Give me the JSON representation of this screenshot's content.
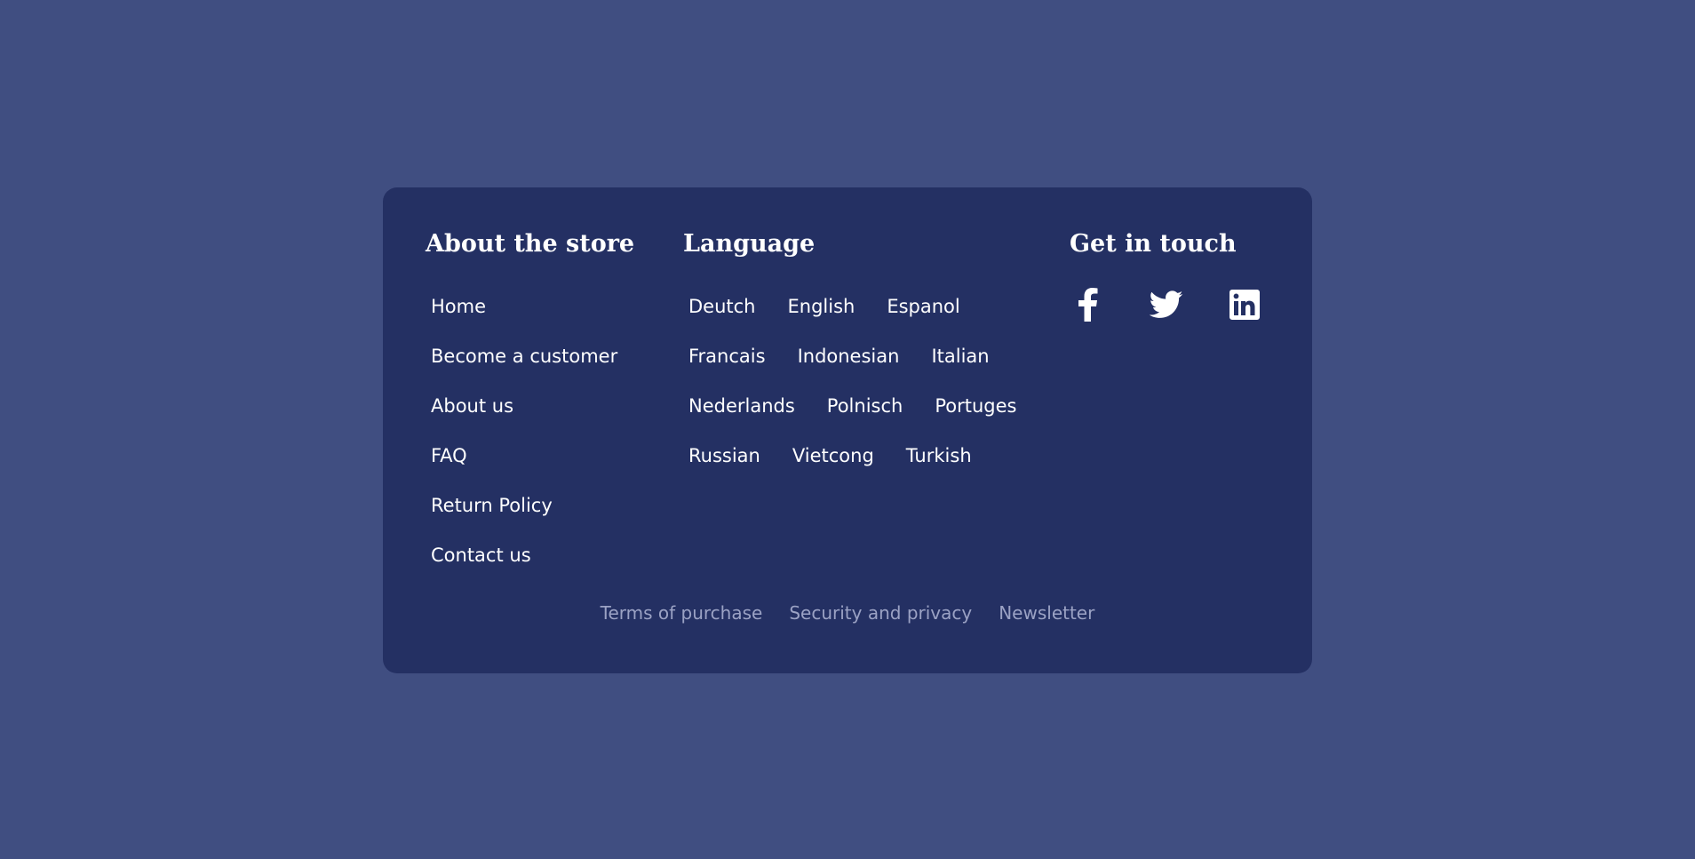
{
  "colors": {
    "page_background": "#404e81",
    "card_background": "#243063",
    "text": "#ffffff",
    "muted_text": "#9ba2c4"
  },
  "about": {
    "title": "About the store",
    "links": [
      "Home",
      "Become a customer",
      "About us",
      "FAQ",
      "Return Policy",
      "Contact us"
    ]
  },
  "language": {
    "title": "Language",
    "rows": [
      [
        "Deutch",
        "English",
        "Espanol"
      ],
      [
        "Francais",
        "Indonesian",
        "Italian"
      ],
      [
        "Nederlands",
        "Polnisch",
        "Portuges"
      ],
      [
        "Russian",
        "Vietcong",
        "Turkish"
      ]
    ]
  },
  "contact": {
    "title": "Get in touch",
    "icons": [
      "facebook-icon",
      "twitter-icon",
      "linkedin-icon"
    ]
  },
  "bottom_links": [
    "Terms of purchase",
    "Security and privacy",
    "Newsletter"
  ]
}
